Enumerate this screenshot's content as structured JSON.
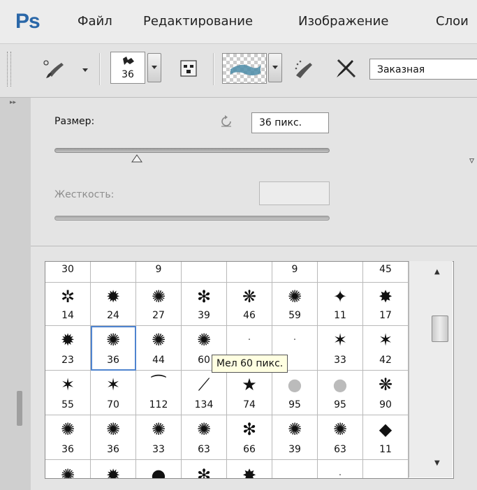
{
  "menu": {
    "logo": "Ps",
    "items": [
      "Файл",
      "Редактирование",
      "Изображение",
      "Слои"
    ]
  },
  "options_bar": {
    "brush_size_badge": "36",
    "preset_select": "Заказная"
  },
  "brush_popup": {
    "size_label": "Размер:",
    "size_value": "36 пикс.",
    "size_slider_percent": 30,
    "hardness_label": "Жесткость:",
    "hardness_value": ""
  },
  "brush_grid": {
    "rows": [
      [
        "30",
        "",
        "9",
        "",
        "",
        "9",
        "",
        "45"
      ],
      [
        "14",
        "24",
        "27",
        "39",
        "46",
        "59",
        "11",
        "17"
      ],
      [
        "23",
        "36",
        "44",
        "60",
        "",
        "",
        "33",
        "42"
      ],
      [
        "55",
        "70",
        "112",
        "134",
        "74",
        "95",
        "95",
        "90"
      ],
      [
        "36",
        "36",
        "33",
        "63",
        "66",
        "39",
        "63",
        "11"
      ],
      [
        "",
        "",
        "",
        "",
        "",
        "",
        "",
        ""
      ]
    ],
    "selected": {
      "row": 2,
      "col": 1
    }
  },
  "tooltip": "Мел 60 пикс.",
  "colors": {
    "logo": "#2a67a8",
    "selection": "#4f84cf",
    "tooltip_bg": "#ffffe1"
  }
}
